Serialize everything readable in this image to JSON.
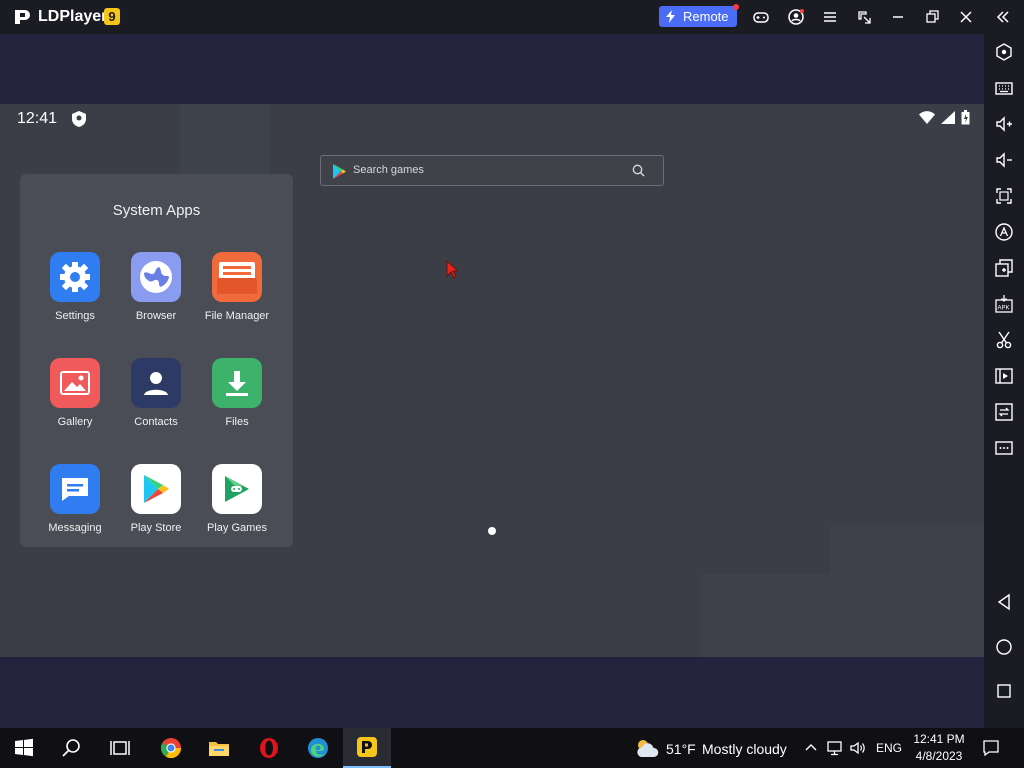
{
  "titlebar": {
    "app_name": "LDPlayer",
    "version_badge": "9",
    "remote_label": "Remote"
  },
  "status_bar": {
    "time": "12:41"
  },
  "search": {
    "placeholder": "Search games"
  },
  "folder": {
    "title": "System Apps",
    "apps": [
      {
        "label": "Settings",
        "icon": "gear-icon",
        "color": "#2f7df0"
      },
      {
        "label": "Browser",
        "icon": "globe-icon",
        "color": "#8a9cf0"
      },
      {
        "label": "File Manager",
        "icon": "folder-icon",
        "color": "#f06a3c"
      },
      {
        "label": "Gallery",
        "icon": "image-icon",
        "color": "#f05a5a"
      },
      {
        "label": "Contacts",
        "icon": "person-icon",
        "color": "#2e3a66"
      },
      {
        "label": "Files",
        "icon": "download-icon",
        "color": "#3db26b"
      },
      {
        "label": "Messaging",
        "icon": "chat-icon",
        "color": "#2f7df0"
      },
      {
        "label": "Play Store",
        "icon": "play-store-icon",
        "color": "#ffffff"
      },
      {
        "label": "Play Games",
        "icon": "play-games-icon",
        "color": "#ffffff"
      }
    ]
  },
  "taskbar": {
    "weather_temp": "51°F",
    "weather_desc": "Mostly cloudy",
    "language": "ENG",
    "time": "12:41 PM",
    "date": "4/8/2023"
  },
  "colors": {
    "accent": "#4a6cf7",
    "badge": "#f5c518",
    "screen_bg": "#3b3e46",
    "frame_bg": "#23233d"
  }
}
